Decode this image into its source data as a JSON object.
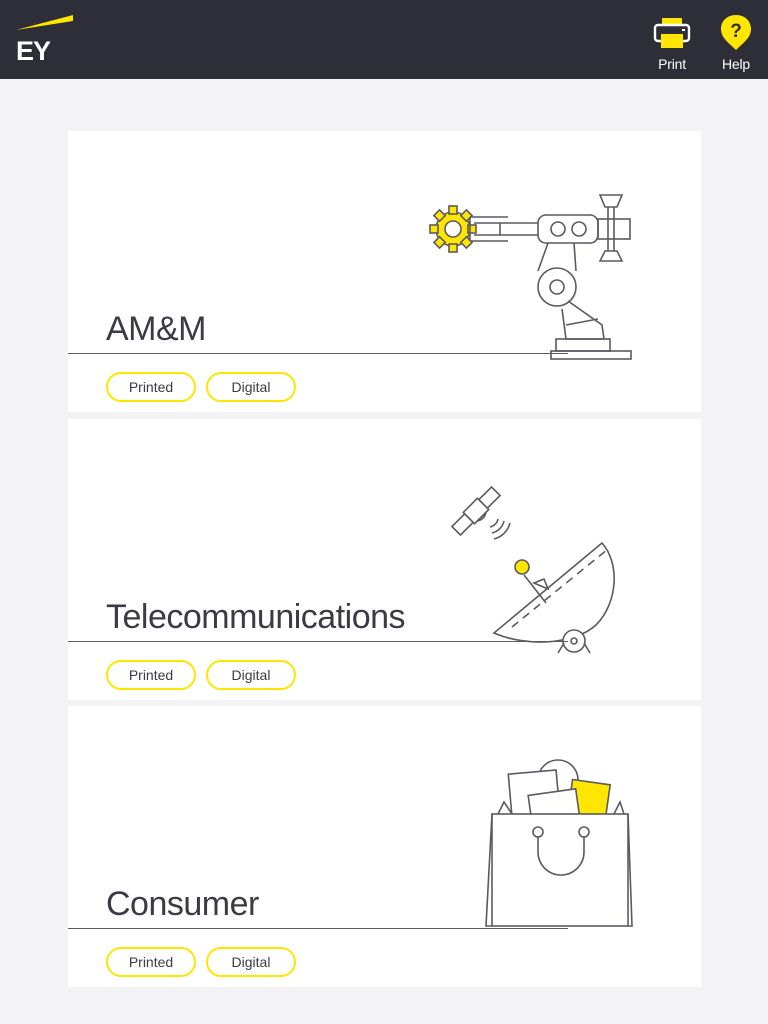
{
  "header": {
    "logo_text": "EY",
    "print_label": "Print",
    "help_label": "Help",
    "brand_color": "#ffe600",
    "bar_color": "#2e2e38"
  },
  "cards": [
    {
      "title": "AM&M",
      "illustration": "robot-arm-icon",
      "printed_label": "Printed",
      "digital_label": "Digital"
    },
    {
      "title": "Telecommunications",
      "illustration": "satellite-dish-icon",
      "printed_label": "Printed",
      "digital_label": "Digital"
    },
    {
      "title": "Consumer",
      "illustration": "shopping-bag-icon",
      "printed_label": "Printed",
      "digital_label": "Digital"
    }
  ]
}
